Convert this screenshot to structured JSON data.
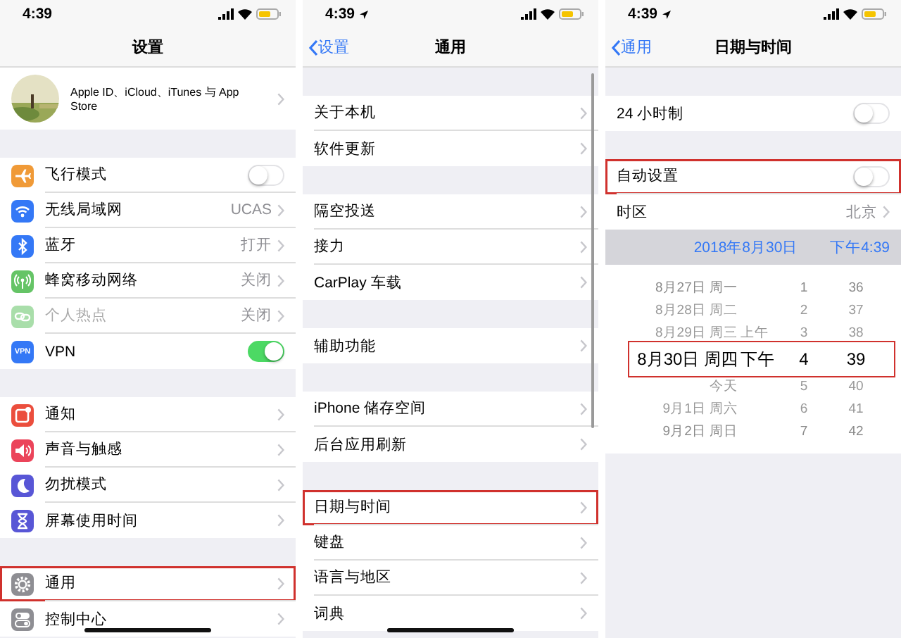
{
  "screens": [
    {
      "status_bar": {
        "time": "4:39",
        "location": false
      },
      "nav": {
        "title": "设置"
      },
      "profile": {
        "subtitle": "Apple ID、iCloud、iTunes 与 App Store"
      },
      "groups": [
        [
          {
            "label": "飞行模式",
            "kind": "toggle",
            "on": false,
            "color": "#f09a37"
          },
          {
            "label": "无线局域网",
            "kind": "link",
            "value": "UCAS",
            "color": "#3478f6"
          },
          {
            "label": "蓝牙",
            "kind": "link",
            "value": "打开",
            "color": "#3478f6"
          },
          {
            "label": "蜂窝移动网络",
            "kind": "link",
            "value": "关闭",
            "color": "#65c466"
          },
          {
            "label": "个人热点",
            "kind": "link",
            "value": "关闭",
            "disabled": true,
            "color": "#a9deaa"
          },
          {
            "label": "VPN",
            "kind": "toggle",
            "on": true,
            "color": "#3478f6",
            "icon_text": "VPN"
          }
        ],
        [
          {
            "label": "通知",
            "kind": "link",
            "color": "#eb4e3d"
          },
          {
            "label": "声音与触感",
            "kind": "link",
            "color": "#eb445a"
          },
          {
            "label": "勿扰模式",
            "kind": "link",
            "color": "#5856d6"
          },
          {
            "label": "屏幕使用时间",
            "kind": "link",
            "color": "#5856d6"
          }
        ],
        [
          {
            "label": "通用",
            "kind": "link",
            "highlighted": true,
            "color": "#8e8e93"
          },
          {
            "label": "控制中心",
            "kind": "link",
            "color": "#8e8e93"
          }
        ]
      ]
    },
    {
      "status_bar": {
        "time": "4:39",
        "location": true
      },
      "nav": {
        "title": "通用",
        "back": "设置"
      },
      "groups": [
        [
          {
            "label": "关于本机",
            "kind": "link"
          },
          {
            "label": "软件更新",
            "kind": "link"
          }
        ],
        [
          {
            "label": "隔空投送",
            "kind": "link"
          },
          {
            "label": "接力",
            "kind": "link"
          },
          {
            "label": "CarPlay 车载",
            "kind": "link"
          }
        ],
        [
          {
            "label": "辅助功能",
            "kind": "link"
          }
        ],
        [
          {
            "label": "iPhone 储存空间",
            "kind": "link"
          },
          {
            "label": "后台应用刷新",
            "kind": "link"
          }
        ],
        [
          {
            "label": "日期与时间",
            "kind": "link",
            "highlighted": true
          },
          {
            "label": "键盘",
            "kind": "link"
          },
          {
            "label": "语言与地区",
            "kind": "link"
          },
          {
            "label": "词典",
            "kind": "link"
          }
        ]
      ]
    },
    {
      "status_bar": {
        "time": "4:39",
        "location": true
      },
      "nav": {
        "title": "日期与时间",
        "back": "通用"
      },
      "groups": [
        [
          {
            "label": "24 小时制",
            "kind": "toggle",
            "on": false
          }
        ],
        [
          {
            "label": "自动设置",
            "kind": "toggle",
            "on": false,
            "highlighted": true
          },
          {
            "label": "时区",
            "kind": "link",
            "value": "北京"
          }
        ]
      ],
      "date_bar": {
        "date": "2018年8月30日",
        "time": "下午4:39"
      },
      "picker": {
        "highlighted": true,
        "rows": [
          {
            "date": "8月27日 周一",
            "hour": "1",
            "minute": "36",
            "selected": false
          },
          {
            "date": "8月28日 周二",
            "hour": "2",
            "minute": "37",
            "selected": false
          },
          {
            "date": "8月29日 周三",
            "ampm": "上午",
            "hour": "3",
            "minute": "38",
            "selected": false
          },
          {
            "date": "8月30日 周四",
            "ampm": "下午",
            "hour": "4",
            "minute": "39",
            "selected": true
          },
          {
            "date": "今天",
            "hour": "5",
            "minute": "40",
            "selected": false
          },
          {
            "date": "9月1日 周六",
            "hour": "6",
            "minute": "41",
            "selected": false
          },
          {
            "date": "9月2日 周日",
            "hour": "7",
            "minute": "42",
            "selected": false
          }
        ]
      }
    }
  ]
}
